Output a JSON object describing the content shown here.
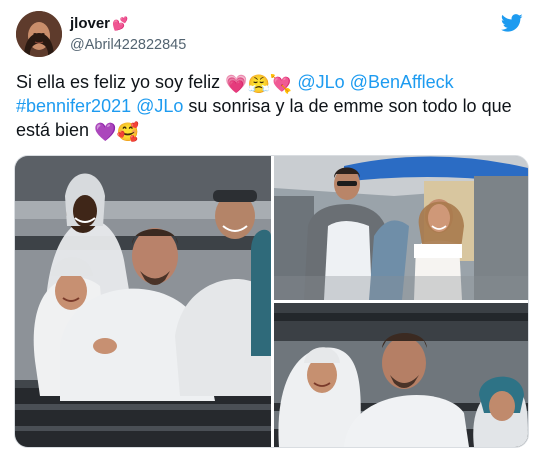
{
  "user": {
    "display_name": "jlover",
    "name_emoji": "💕",
    "handle": "@Abril422822845"
  },
  "tweet": {
    "text_1": "Si ella es feliz yo soy feliz ",
    "emoji_1": "💗😤💘",
    "mention_1": "@JLo",
    "mention_2": "@BenAffleck",
    "hashtag": "#bennifer2021",
    "mention_3": "@JLo",
    "text_2": " su sonrisa y la de emme son todo lo que está bien ",
    "emoji_2": "💜🥰"
  },
  "colors": {
    "link": "#1d9bf0",
    "text": "#0f1419",
    "secondary": "#536471"
  },
  "icons": {
    "brand": "twitter-bird-icon"
  }
}
